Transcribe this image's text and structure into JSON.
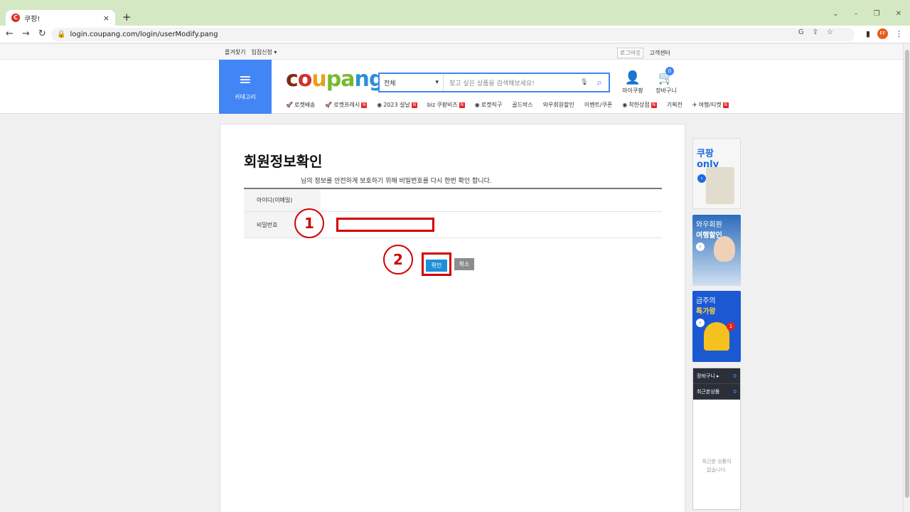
{
  "browser": {
    "tab_title": "쿠팡!",
    "tab_favicon": "C",
    "tab_close": "×",
    "new_tab": "+",
    "window_controls": [
      "⌄",
      "–",
      "❐",
      "✕"
    ],
    "url": "login.coupang.com/login/userModify.pang",
    "avatar": "FF",
    "nav_back": "←",
    "nav_forward": "→",
    "nav_reload": "↻"
  },
  "topbar": {
    "favorites": "즐겨찾기",
    "seller": "입점신청 ▾",
    "logout": "로그아웃",
    "support": "고객센터"
  },
  "header": {
    "category_label": "카테고리",
    "logo_parts": [
      "c",
      "o",
      "u",
      "pa",
      "ng"
    ],
    "search_category": "전체",
    "search_placeholder": "찾고 싶은 상품을 검색해보세요!",
    "my_coupang": "마이쿠팡",
    "cart": "장바구니",
    "cart_count": "0"
  },
  "menu": [
    {
      "label": "로켓배송",
      "icon": "🚀",
      "new": false
    },
    {
      "label": "로켓프레시",
      "icon": "🚀",
      "new": true
    },
    {
      "label": "2023 설날",
      "icon": "◉",
      "new": true
    },
    {
      "label": "쿠팡비즈",
      "icon": "biz",
      "new": true
    },
    {
      "label": "로켓직구",
      "icon": "◉",
      "new": false
    },
    {
      "label": "골드박스",
      "icon": "",
      "new": false
    },
    {
      "label": "와우회원할인",
      "icon": "",
      "new": false
    },
    {
      "label": "이벤트/쿠폰",
      "icon": "",
      "new": false
    },
    {
      "label": "착한상점",
      "icon": "◉",
      "new": true
    },
    {
      "label": "기획전",
      "icon": "",
      "new": false
    },
    {
      "label": "여행/티켓",
      "icon": "✈",
      "new": true
    }
  ],
  "main": {
    "title": "회원정보확인",
    "description": "님의 정보를 안전하게 보호하기 위해 비밀번호를 다시 한번 확인 합니다.",
    "id_label": "아이디(이메일)",
    "password_label": "비밀번호",
    "password_value": "",
    "confirm_button": "확인",
    "cancel_button": "취소",
    "marker_1": "1",
    "marker_2": "2"
  },
  "side": {
    "banner1_title": "쿠팡 only",
    "banner2_line1": "와우회원",
    "banner2_line2": "여행할인",
    "banner3_line1": "금주의",
    "banner3_line2": "특가왕",
    "banner3_badge": "1",
    "recent_cart": "장바구니 ▸",
    "recent_cart_count": "0",
    "recent_viewed": "최근본상품",
    "recent_viewed_count": "0",
    "recent_empty_1": "최근본 상품이",
    "recent_empty_2": "없습니다."
  },
  "colors": {
    "accent": "#4285f4",
    "annotation_red": "#d10000",
    "confirm_blue": "#1e8fd8"
  }
}
